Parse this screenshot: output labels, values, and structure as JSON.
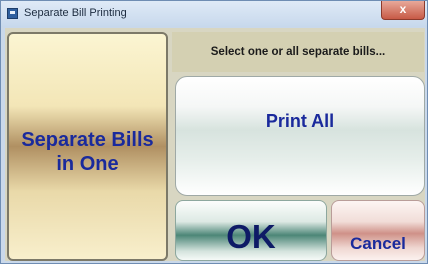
{
  "window": {
    "title": "Separate Bill Printing",
    "close_label": "x",
    "icon": "app-icon"
  },
  "dialog": {
    "prompt": "Select one or all separate bills...",
    "buttons": {
      "merge_label": "Separate Bills\nin One",
      "print_all_label": "Print All",
      "ok_label": "OK",
      "cancel_label": "Cancel"
    }
  },
  "colors": {
    "button_text": "#1a2a9c",
    "ok_text": "#0e1b66",
    "client_background": "#d8d6c2",
    "prompt_bar": "#d4d0b2"
  }
}
